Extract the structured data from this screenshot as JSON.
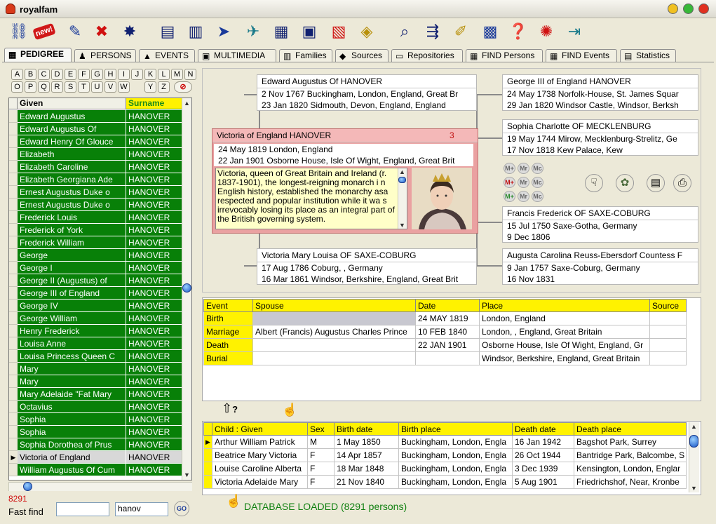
{
  "window": {
    "title": "royalfam"
  },
  "toolbar": [
    {
      "name": "chain-icon",
      "glyph": "⛓",
      "cls": "blue"
    },
    {
      "name": "new-icon",
      "glyph": "new!",
      "cls": "new"
    },
    {
      "name": "edit-icon",
      "glyph": "✎",
      "cls": "blue"
    },
    {
      "name": "delete-icon",
      "glyph": "✖",
      "cls": "red"
    },
    {
      "name": "compass-icon",
      "glyph": "✸",
      "cls": "navy"
    },
    {
      "name": "gedcom-import-icon",
      "glyph": "▤",
      "cls": "navy"
    },
    {
      "name": "gedcom-export-icon",
      "glyph": "▥",
      "cls": "navy"
    },
    {
      "name": "send-icon",
      "glyph": "➤",
      "cls": "blue"
    },
    {
      "name": "send-record-icon",
      "glyph": "✈",
      "cls": "teal"
    },
    {
      "name": "printer-list-icon",
      "glyph": "▦",
      "cls": "navy"
    },
    {
      "name": "report-icon",
      "glyph": "▣",
      "cls": "navy"
    },
    {
      "name": "pdf-icon",
      "glyph": "▧",
      "cls": "red"
    },
    {
      "name": "web-icon",
      "glyph": "◈",
      "cls": "gold"
    },
    {
      "name": "search-icon",
      "glyph": "⌕",
      "cls": "navy"
    },
    {
      "name": "tree-icon",
      "glyph": "⇶",
      "cls": "navy"
    },
    {
      "name": "note-icon",
      "glyph": "✐",
      "cls": "gold"
    },
    {
      "name": "calendar-icon",
      "glyph": "▩",
      "cls": "blue"
    },
    {
      "name": "help-book-icon",
      "glyph": "❓",
      "cls": "purple"
    },
    {
      "name": "tip-icon",
      "glyph": "✺",
      "cls": "red"
    },
    {
      "name": "exit-icon",
      "glyph": "⇥",
      "cls": "teal"
    }
  ],
  "tabs": [
    "PEDIGREE",
    "PERSONS",
    "EVENTS",
    "MULTIMEDIA",
    "Families",
    "Sources",
    "Repositories",
    "FIND Persons",
    "FIND Events",
    "Statistics"
  ],
  "alphabet": {
    "row1": [
      "A",
      "B",
      "C",
      "D",
      "E",
      "F",
      "G",
      "H",
      "I",
      "J",
      "K",
      "L",
      "M",
      "N"
    ],
    "row2": [
      "O",
      "P",
      "Q",
      "R",
      "S",
      "T",
      "U",
      "V",
      "W",
      "Y",
      "Z"
    ]
  },
  "person_list": {
    "headers": {
      "given": "Given",
      "surname": "Surname"
    },
    "rows": [
      {
        "given": "Edward Augustus",
        "surname": "HANOVER"
      },
      {
        "given": "Edward Augustus Of",
        "surname": "HANOVER"
      },
      {
        "given": "Edward Henry Of Glouce",
        "surname": "HANOVER"
      },
      {
        "given": "Elizabeth",
        "surname": "HANOVER"
      },
      {
        "given": "Elizabeth Caroline",
        "surname": "HANOVER"
      },
      {
        "given": "Elizabeth Georgiana Ade",
        "surname": "HANOVER"
      },
      {
        "given": "Ernest Augustus Duke o",
        "surname": "HANOVER"
      },
      {
        "given": "Ernest Augustus Duke o",
        "surname": "HANOVER"
      },
      {
        "given": "Frederick Louis",
        "surname": "HANOVER"
      },
      {
        "given": "Frederick of York",
        "surname": "HANOVER"
      },
      {
        "given": "Frederick William",
        "surname": "HANOVER"
      },
      {
        "given": "George",
        "surname": "HANOVER"
      },
      {
        "given": "George I",
        "surname": "HANOVER"
      },
      {
        "given": "George II (Augustus) of",
        "surname": "HANOVER"
      },
      {
        "given": "George III of England",
        "surname": "HANOVER"
      },
      {
        "given": "George IV",
        "surname": "HANOVER"
      },
      {
        "given": "George William",
        "surname": "HANOVER"
      },
      {
        "given": "Henry Frederick",
        "surname": "HANOVER"
      },
      {
        "given": "Louisa Anne",
        "surname": "HANOVER"
      },
      {
        "given": "Louisa Princess Queen C",
        "surname": "HANOVER"
      },
      {
        "given": "Mary",
        "surname": "HANOVER"
      },
      {
        "given": "Mary",
        "surname": "HANOVER"
      },
      {
        "given": "Mary Adelaide \"Fat Mary",
        "surname": "HANOVER"
      },
      {
        "given": "Octavius",
        "surname": "HANOVER"
      },
      {
        "given": "Sophia",
        "surname": "HANOVER"
      },
      {
        "given": "Sophia",
        "surname": "HANOVER"
      },
      {
        "given": "Sophia Dorothea of Prus",
        "surname": "HANOVER"
      },
      {
        "given": "Victoria of England",
        "surname": "HANOVER",
        "selected": true
      },
      {
        "given": "William Augustus Of Cum",
        "surname": "HANOVER"
      }
    ],
    "count": "8291"
  },
  "fast_find": {
    "label": "Fast find",
    "value1": "",
    "value2": "hanov",
    "go": "GO"
  },
  "pedigree": {
    "father": {
      "name": "Edward Augustus Of   HANOVER",
      "birth": "2 Nov 1767   Buckingham, London, England, Great Br",
      "death": "23 Jan 1820   Sidmouth, Devon, England, England"
    },
    "mother": {
      "name": "Victoria Mary Louisa   OF SAXE-COBURG",
      "birth": "17 Aug 1786   Coburg, , Germany",
      "death": "16 Mar 1861   Windsor, Berkshire, England, Great Brit"
    },
    "ff": {
      "name": "George III of England   HANOVER",
      "birth": "24 May 1738   Norfolk-House, St. James Squar",
      "death": "29 Jan 1820   Windsor Castle, Windsor, Berksh"
    },
    "fm": {
      "name": "Sophia Charlotte   OF MECKLENBURG",
      "birth": "19 May 1744   Mirow, Mecklenburg-Strelitz, Ge",
      "death": "17 Nov 1818   Kew Palace, Kew"
    },
    "mf": {
      "name": "Francis Frederick   OF SAXE-COBURG",
      "birth": "15 Jul 1750   Saxe-Gotha, Germany",
      "death": "9 Dec 1806"
    },
    "mm": {
      "name": "Augusta Carolina Reuss-Ebersdorf Countess   F",
      "birth": "9 Jan 1757   Saxe-Coburg, Germany",
      "death": "16 Nov 1831"
    },
    "subject": {
      "name": "Victoria of England   HANOVER",
      "children": "3",
      "birth": "24 May 1819   London, England",
      "death": "22 Jan 1901   Osborne House, Isle Of Wight, England, Great Brit",
      "note": "Victoria, queen of Great Britain and Ireland (r. 1837-1901), the longest-reigning monarch i n English history, established the monarchy asa respected and popular institution while it wa s irrevocably losing its place as an integral part of the British governing system."
    }
  },
  "marriage_buttons": [
    "M+",
    "Mr",
    "Mc",
    "M+",
    "Mr",
    "Mc",
    "M+",
    "Mr",
    "Mc"
  ],
  "events": {
    "headers": [
      "Event",
      "Spouse",
      "Date",
      "Place",
      "Source"
    ],
    "rows": [
      [
        "Birth",
        "",
        "24 MAY 1819",
        "London, England",
        ""
      ],
      [
        "Marriage",
        "Albert (Francis) Augustus Charles Prince",
        "10 FEB 1840",
        "London, , England, Great Britain",
        ""
      ],
      [
        "Death",
        "",
        "22 JAN 1901",
        "Osborne House, Isle Of Wight, England, Gr",
        ""
      ],
      [
        "Burial",
        "",
        "",
        "Windsor, Berkshire, England, Great Britain",
        ""
      ]
    ]
  },
  "children": {
    "headers": [
      "Child : Given",
      "Sex",
      "Birth date",
      "Birth place",
      "Death date",
      "Death place"
    ],
    "rows": [
      [
        "Arthur William Patrick",
        "M",
        "1 May 1850",
        "Buckingham, London, Engla",
        "16 Jan 1942",
        "Bagshot Park, Surrey"
      ],
      [
        "Beatrice Mary Victoria",
        "F",
        "14 Apr 1857",
        "Buckingham, London, Engla",
        "26 Oct 1944",
        "Bantridge Park, Balcombe, S"
      ],
      [
        "Louise Caroline Alberta",
        "F",
        "18 Mar 1848",
        "Buckingham, London, Engla",
        "3 Dec 1939",
        "Kensington, London, Englar"
      ],
      [
        "Victoria Adelaide Mary",
        "F",
        "21 Nov 1840",
        "Buckingham, London, Engla",
        "5 Aug 1901",
        "Friedrichshof, Near, Kronbe"
      ]
    ]
  },
  "status": "DATABASE LOADED    (8291 persons)"
}
